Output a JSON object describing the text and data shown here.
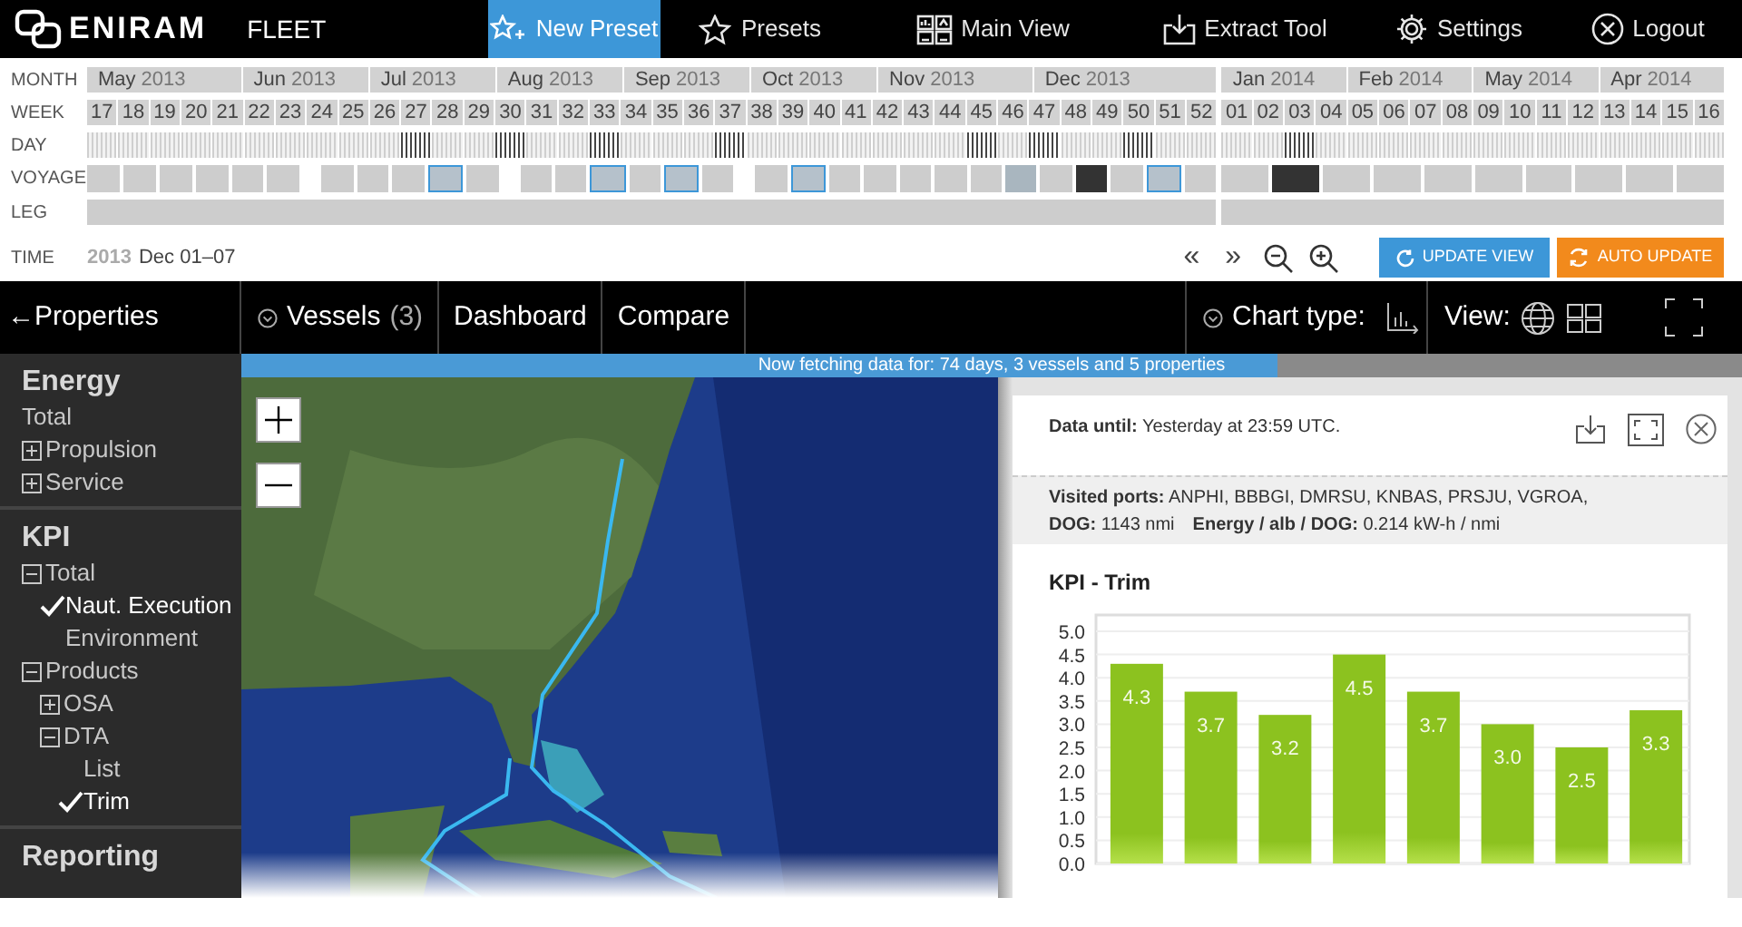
{
  "nav": {
    "brand": "ENIRAM",
    "product": "FLEET",
    "items": [
      {
        "label": "New Preset",
        "kind": "new-preset",
        "selected": true
      },
      {
        "label": "Presets",
        "kind": "presets",
        "selected": false
      },
      {
        "label": "Main View",
        "kind": "main-view",
        "selected": false
      },
      {
        "label": "Extract Tool",
        "kind": "extract",
        "selected": false
      },
      {
        "label": "Settings",
        "kind": "settings",
        "selected": false
      },
      {
        "label": "Logout",
        "kind": "logout",
        "selected": false
      }
    ]
  },
  "timeline": {
    "row_labels": {
      "month": "MONTH",
      "week": "WEEK",
      "day": "DAY",
      "voyage": "VOYAGE",
      "leg": "LEG",
      "time": "TIME"
    },
    "segments": [
      {
        "months": [
          {
            "month": "May",
            "year": "2013",
            "weeks": [
              {
                "label": "17",
                "has_data": false
              },
              {
                "label": "18",
                "has_data": false
              },
              {
                "label": "19",
                "has_data": false
              },
              {
                "label": "20",
                "has_data": false
              },
              {
                "label": "21",
                "has_data": false
              }
            ]
          },
          {
            "month": "Jun",
            "year": "2013",
            "weeks": [
              {
                "label": "22",
                "has_data": false
              },
              {
                "label": "23",
                "has_data": false
              },
              {
                "label": "24",
                "has_data": false
              },
              {
                "label": "25",
                "has_data": false
              }
            ]
          },
          {
            "month": "Jul",
            "year": "2013",
            "weeks": [
              {
                "label": "26",
                "has_data": false
              },
              {
                "label": "27",
                "has_data": true
              },
              {
                "label": "28",
                "has_data": false
              },
              {
                "label": "29",
                "has_data": false
              }
            ]
          },
          {
            "month": "Aug",
            "year": "2013",
            "weeks": [
              {
                "label": "30",
                "has_data": true
              },
              {
                "label": "31",
                "has_data": false
              },
              {
                "label": "32",
                "has_data": false
              },
              {
                "label": "33",
                "has_data": true
              }
            ]
          },
          {
            "month": "Sep",
            "year": "2013",
            "weeks": [
              {
                "label": "34",
                "has_data": false
              },
              {
                "label": "35",
                "has_data": false
              },
              {
                "label": "36",
                "has_data": false
              },
              {
                "label": "37",
                "has_data": true
              }
            ]
          },
          {
            "month": "Oct",
            "year": "2013",
            "weeks": [
              {
                "label": "38",
                "has_data": false
              },
              {
                "label": "39",
                "has_data": false
              },
              {
                "label": "40",
                "has_data": false
              },
              {
                "label": "41",
                "has_data": false
              }
            ]
          },
          {
            "month": "Nov",
            "year": "2013",
            "weeks": [
              {
                "label": "42",
                "has_data": false
              },
              {
                "label": "43",
                "has_data": false
              },
              {
                "label": "44",
                "has_data": false
              },
              {
                "label": "45",
                "has_data": true
              },
              {
                "label": "46",
                "has_data": false
              }
            ]
          },
          {
            "month": "Dec",
            "year": "2013",
            "weeks": [
              {
                "label": "47",
                "has_data": true
              },
              {
                "label": "48",
                "has_data": false
              },
              {
                "label": "49",
                "has_data": false
              },
              {
                "label": "50",
                "has_data": true
              },
              {
                "label": "51",
                "has_data": false
              },
              {
                "label": "52",
                "has_data": false
              }
            ]
          }
        ],
        "voyage_groups": [
          {
            "voyages": [
              {
                "selected": false,
                "current": false,
                "highlighted": false
              },
              {
                "selected": false,
                "current": false,
                "highlighted": false
              },
              {
                "selected": false,
                "current": false,
                "highlighted": false
              },
              {
                "selected": false,
                "current": false,
                "highlighted": false
              },
              {
                "selected": false,
                "current": false,
                "highlighted": false
              },
              {
                "selected": false,
                "current": false,
                "highlighted": false
              }
            ]
          },
          {
            "voyages": [
              {
                "selected": false,
                "current": false,
                "highlighted": false
              },
              {
                "selected": false,
                "current": false,
                "highlighted": false
              },
              {
                "selected": false,
                "current": false,
                "highlighted": false
              },
              {
                "selected": true,
                "current": false,
                "highlighted": false
              },
              {
                "selected": false,
                "current": false,
                "highlighted": false
              }
            ]
          },
          {
            "voyages": [
              {
                "selected": false,
                "current": false,
                "highlighted": false
              },
              {
                "selected": false,
                "current": false,
                "highlighted": false
              },
              {
                "selected": true,
                "current": false,
                "highlighted": false
              },
              {
                "selected": false,
                "current": false,
                "highlighted": false
              },
              {
                "selected": true,
                "current": false,
                "highlighted": false
              },
              {
                "selected": false,
                "current": false,
                "highlighted": false
              }
            ]
          },
          {
            "voyages": [
              {
                "selected": false,
                "current": false,
                "highlighted": false
              },
              {
                "selected": true,
                "current": false,
                "highlighted": false
              },
              {
                "selected": false,
                "current": false,
                "highlighted": false
              },
              {
                "selected": false,
                "current": false,
                "highlighted": false
              },
              {
                "selected": false,
                "current": false,
                "highlighted": false
              },
              {
                "selected": false,
                "current": false,
                "highlighted": false
              },
              {
                "selected": false,
                "current": false,
                "highlighted": false
              },
              {
                "selected": false,
                "current": false,
                "highlighted": true
              },
              {
                "selected": false,
                "current": false,
                "highlighted": false
              },
              {
                "selected": false,
                "current": true,
                "highlighted": false
              },
              {
                "selected": false,
                "current": false,
                "highlighted": false
              },
              {
                "selected": true,
                "current": false,
                "highlighted": false
              },
              {
                "selected": false,
                "current": false,
                "highlighted": false
              }
            ]
          }
        ]
      },
      {
        "months": [
          {
            "month": "Jan",
            "year": "2014",
            "weeks": [
              {
                "label": "01",
                "has_data": false
              },
              {
                "label": "02",
                "has_data": false
              },
              {
                "label": "03",
                "has_data": true
              },
              {
                "label": "04",
                "has_data": false
              }
            ]
          },
          {
            "month": "Feb",
            "year": "2014",
            "weeks": [
              {
                "label": "05",
                "has_data": false
              },
              {
                "label": "06",
                "has_data": false
              },
              {
                "label": "07",
                "has_data": false
              },
              {
                "label": "08",
                "has_data": false
              }
            ]
          },
          {
            "month": "May",
            "year": "2014",
            "weeks": [
              {
                "label": "09",
                "has_data": false
              },
              {
                "label": "10",
                "has_data": false
              },
              {
                "label": "11",
                "has_data": false
              },
              {
                "label": "12",
                "has_data": false
              }
            ]
          },
          {
            "month": "Apr",
            "year": "2014",
            "weeks": [
              {
                "label": "13",
                "has_data": false
              },
              {
                "label": "14",
                "has_data": false
              },
              {
                "label": "15",
                "has_data": false
              },
              {
                "label": "16",
                "has_data": false
              }
            ]
          }
        ],
        "voyage_groups": [
          {
            "voyages": [
              {
                "selected": false,
                "current": false,
                "highlighted": false
              },
              {
                "selected": false,
                "current": true,
                "highlighted": false
              },
              {
                "selected": false,
                "current": false,
                "highlighted": false
              },
              {
                "selected": false,
                "current": false,
                "highlighted": false
              },
              {
                "selected": false,
                "current": false,
                "highlighted": false
              },
              {
                "selected": false,
                "current": false,
                "highlighted": false
              },
              {
                "selected": false,
                "current": false,
                "highlighted": false
              },
              {
                "selected": false,
                "current": false,
                "highlighted": false
              },
              {
                "selected": false,
                "current": false,
                "highlighted": false
              },
              {
                "selected": false,
                "current": false,
                "highlighted": false
              }
            ]
          }
        ]
      }
    ],
    "time": {
      "year": "2013",
      "range": "Dec 01–07"
    },
    "controls": {
      "back": "«",
      "forward": "»",
      "update": "UPDATE VIEW",
      "auto_update": "AUTO UPDATE"
    }
  },
  "toolbar": {
    "back": "←Properties",
    "vessels": {
      "label": "Vessels",
      "count": "(3)"
    },
    "tabs": [
      "Dashboard",
      "Compare"
    ],
    "chart_type": "Chart type:",
    "view": "View:"
  },
  "status": {
    "text": "Now fetching data for: 74 days, 3 vessels and 5 properties",
    "level": 0.69
  },
  "sidebar": {
    "sections": [
      {
        "title": "Energy",
        "items": [
          {
            "label": "Total"
          },
          {
            "label": "Propulsion",
            "expanded": false
          },
          {
            "label": "Service",
            "expanded": false
          }
        ]
      },
      {
        "title": "KPI",
        "items": [
          {
            "label": "Total",
            "expanded": true,
            "children": [
              {
                "label": "Naut. Execution",
                "checked": true
              },
              {
                "label": "Environment",
                "checked": false
              }
            ]
          },
          {
            "label": "Products",
            "expanded": true,
            "children": [
              {
                "label": "OSA",
                "expanded": false
              },
              {
                "label": "DTA",
                "expanded": true,
                "children": [
                  {
                    "label": "List",
                    "checked": false
                  },
                  {
                    "label": "Trim",
                    "checked": true
                  }
                ]
              }
            ]
          }
        ]
      },
      {
        "title": "Reporting"
      }
    ]
  },
  "panel": {
    "data_until": "**Data until:** Yesterday at 23:59 UTC.",
    "info": [
      "**Visited ports:** ANPHI, BBBGI, DMRSU, KNBAS, PRSJU, VGROA,",
      "**DOG:** 1143 nmi",
      "**Energy / alb / DOG:** 0.214 kW-h / nmi"
    ],
    "chart_data": {
      "type": "bar",
      "title": "KPI - Trim",
      "grid": true,
      "ylim": [
        0,
        5
      ],
      "yticks": [
        {
          "value": 0,
          "label": "0.0"
        },
        {
          "value": 0.5,
          "label": "0.5"
        },
        {
          "value": 1,
          "label": "1.0"
        },
        {
          "value": 1.5,
          "label": "1.5"
        },
        {
          "value": 2,
          "label": "2.0"
        },
        {
          "value": 2.5,
          "label": "2.5"
        },
        {
          "value": 3,
          "label": "3.0"
        },
        {
          "value": 3.5,
          "label": "3.5"
        },
        {
          "value": 4,
          "label": "4.0"
        },
        {
          "value": 4.5,
          "label": "4.5"
        },
        {
          "value": 5,
          "label": "5.0"
        }
      ],
      "series": [
        {
          "color": "#8cc21f",
          "values": [
            4.3,
            3.7,
            3.2,
            4.5,
            3.7,
            3.0,
            2.5,
            3.3
          ]
        }
      ],
      "value_labels": [
        "4.3",
        "3.7",
        "3.2",
        "4.5",
        "3.7",
        "3.0",
        "2.5",
        "3.3"
      ]
    }
  }
}
